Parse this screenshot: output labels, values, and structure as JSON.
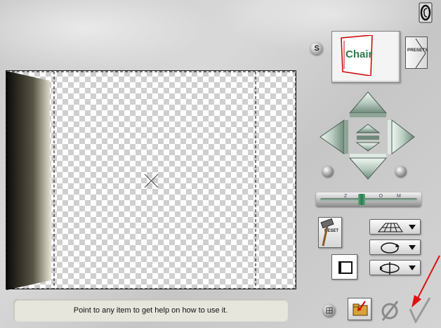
{
  "help": {
    "text": "Point to any item to get help on how to use it."
  },
  "buttons": {
    "s_label": "S",
    "presets_label": "PRESETS",
    "reset_label": "RESET"
  },
  "zoom": {
    "label": "Z O O M",
    "level": 0.42
  },
  "preview_thumbnail": {
    "text": "Chair"
  },
  "icons": {
    "top_right": "copyright-logo-icon",
    "up": "arrow-up-icon",
    "down": "arrow-down-icon",
    "left": "arrow-left-icon",
    "right": "arrow-right-icon",
    "rotate_left": "rotate-left-icon",
    "rotate_right": "rotate-right-icon",
    "perspective": "perspective-grid-icon",
    "rotate_z": "rotate-circle-icon",
    "rotate_y": "rotate-axis-icon",
    "frame": "frame-toggle-icon",
    "grid": "grid-icon",
    "save": "save-preset-icon",
    "cancel": "cancel-icon",
    "ok": "ok-checkmark-icon"
  },
  "colors": {
    "annotation_arrow": "#e01010",
    "nav_button": "#b9ccc1"
  }
}
